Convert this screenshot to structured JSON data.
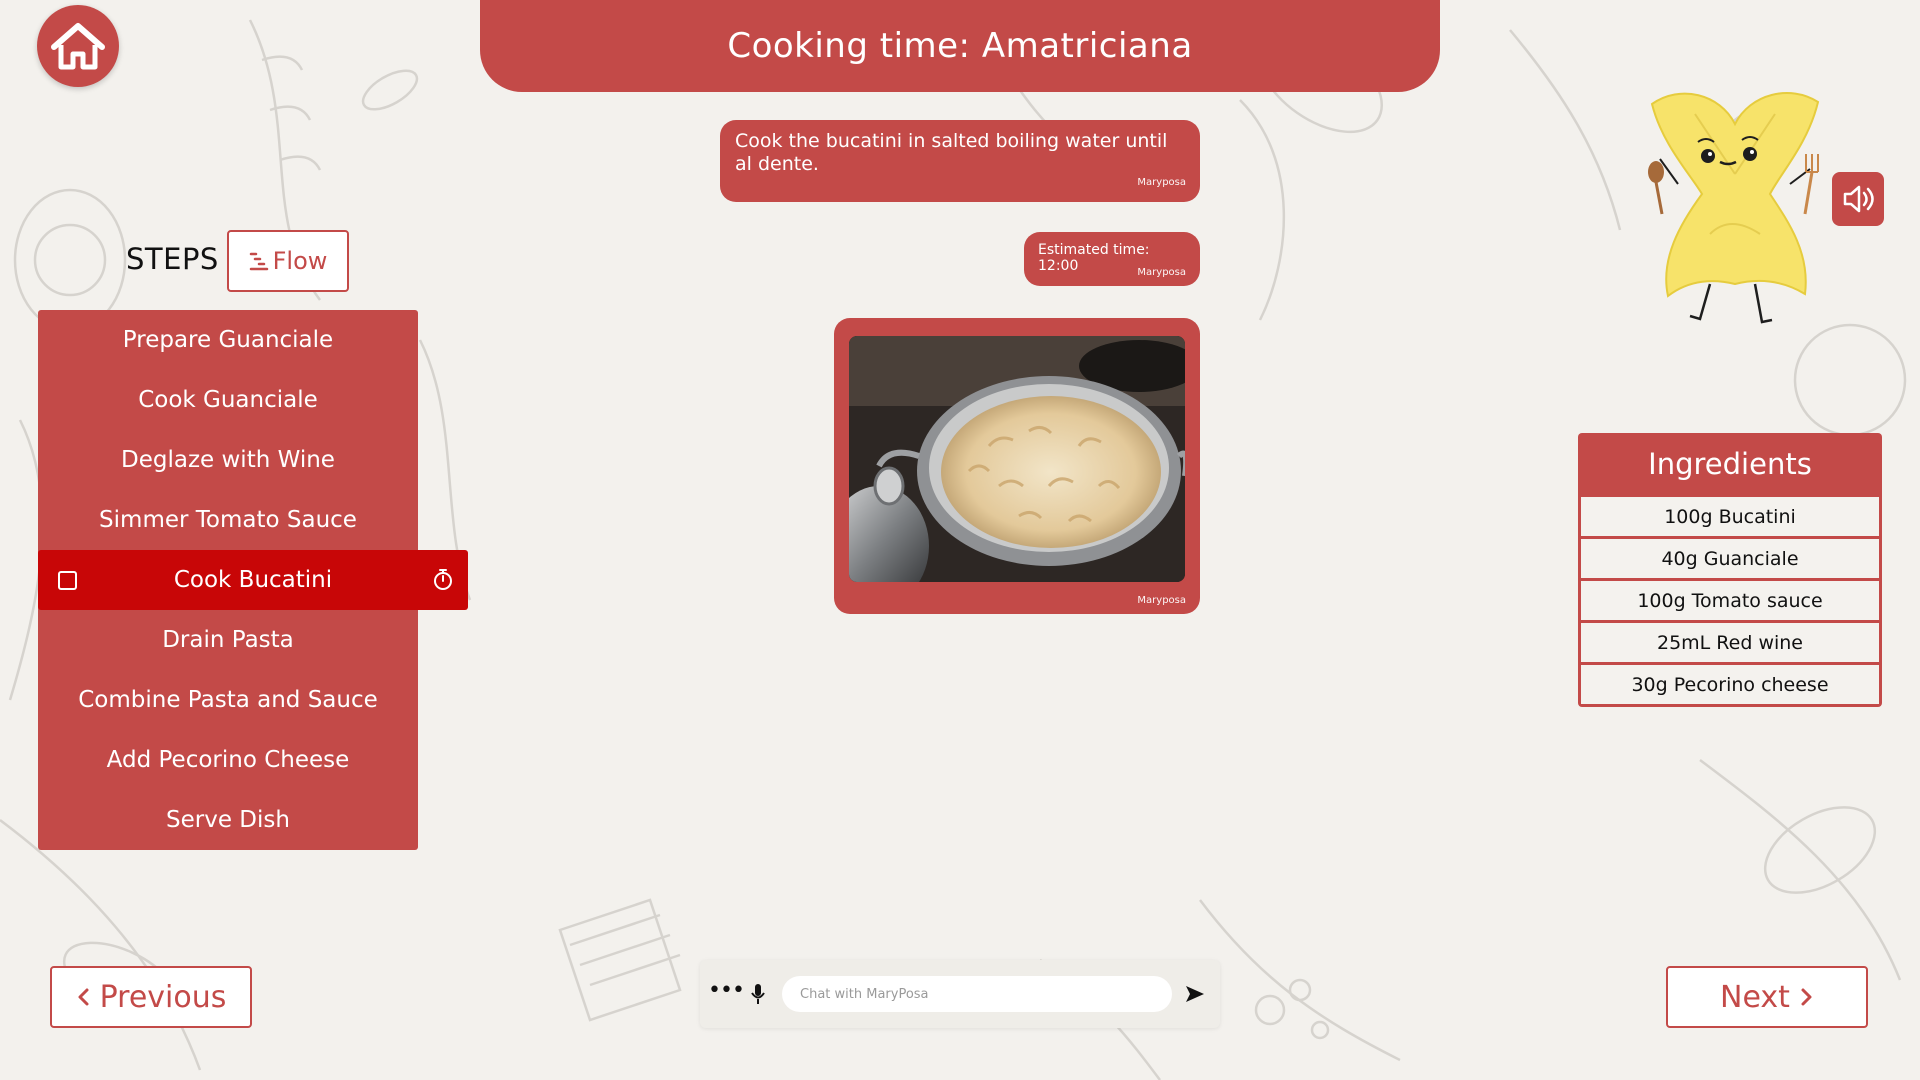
{
  "theme": {
    "accent": "#c34a48",
    "active_step": "#c80607",
    "background": "#f3f1ed"
  },
  "header": {
    "title": "Cooking time: Amatriciana",
    "home_icon": "home-icon"
  },
  "chat": {
    "messages": [
      {
        "text": "Cook the bucatini in salted boiling water until al dente.",
        "author": "Maryposa"
      },
      {
        "text": "Estimated time: 12:00",
        "author": "Maryposa"
      },
      {
        "image": "pot-of-boiling-pasta",
        "author": "Maryposa"
      }
    ],
    "input_placeholder": "Chat with MaryPosa"
  },
  "steps": {
    "title": "STEPS",
    "flow_label": "Flow",
    "items": [
      "Prepare Guanciale",
      "Cook Guanciale",
      "Deglaze with Wine",
      "Simmer Tomato Sauce",
      "Cook Bucatini",
      "Drain Pasta",
      "Combine Pasta and Sauce",
      "Add Pecorino Cheese",
      "Serve Dish"
    ],
    "active_index": 4
  },
  "ingredients": {
    "title": "Ingredients",
    "items": [
      "100g Bucatini",
      "40g Guanciale",
      "100g Tomato sauce",
      "25mL Red wine",
      "30g Pecorino cheese"
    ]
  },
  "nav": {
    "previous": "Previous",
    "next": "Next"
  }
}
